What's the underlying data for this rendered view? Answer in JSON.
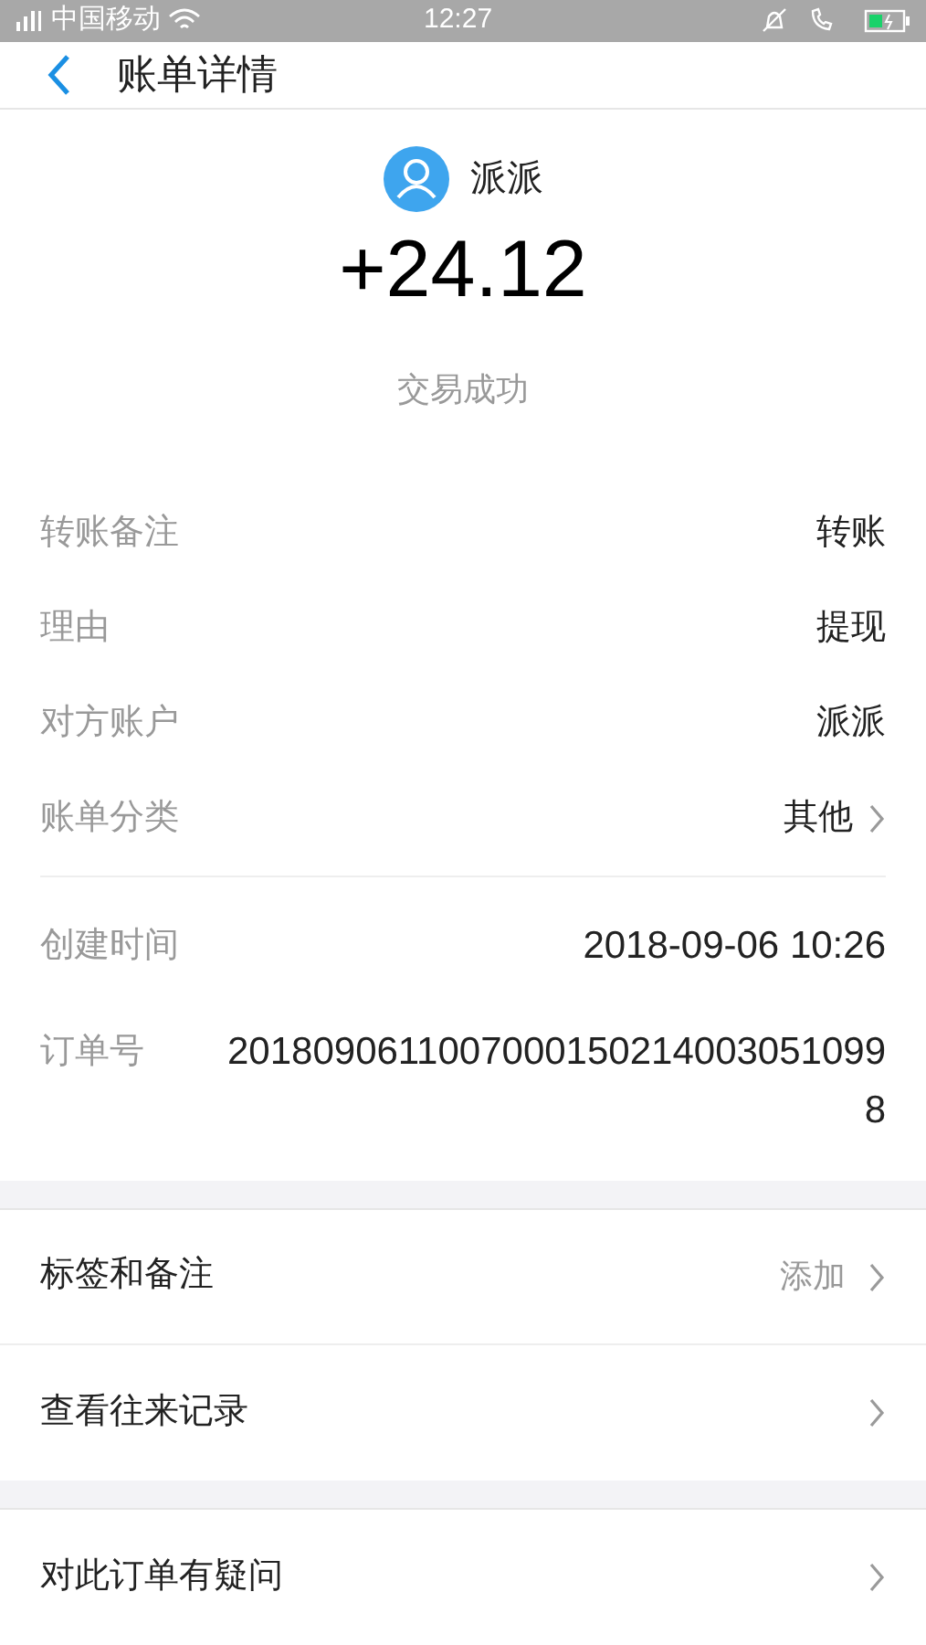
{
  "status_bar": {
    "carrier": "中国移动",
    "time": "12:27"
  },
  "header": {
    "title": "账单详情"
  },
  "summary": {
    "name": "派派",
    "amount": "+24.12",
    "status": "交易成功"
  },
  "details": [
    {
      "label": "转账备注",
      "value": "转账",
      "arrow": false
    },
    {
      "label": "理由",
      "value": "提现",
      "arrow": false
    },
    {
      "label": "对方账户",
      "value": "派派",
      "arrow": false
    },
    {
      "label": "账单分类",
      "value": "其他",
      "arrow": true
    }
  ],
  "meta": [
    {
      "label": "创建时间",
      "value": "2018-09-06 10:26"
    },
    {
      "label": "订单号",
      "value": "20180906110070001502140030510998"
    }
  ],
  "groups": [
    [
      {
        "label": "标签和备注",
        "value": "添加"
      },
      {
        "label": "查看往来记录"
      }
    ],
    [
      {
        "label": "对此订单有疑问"
      }
    ]
  ]
}
